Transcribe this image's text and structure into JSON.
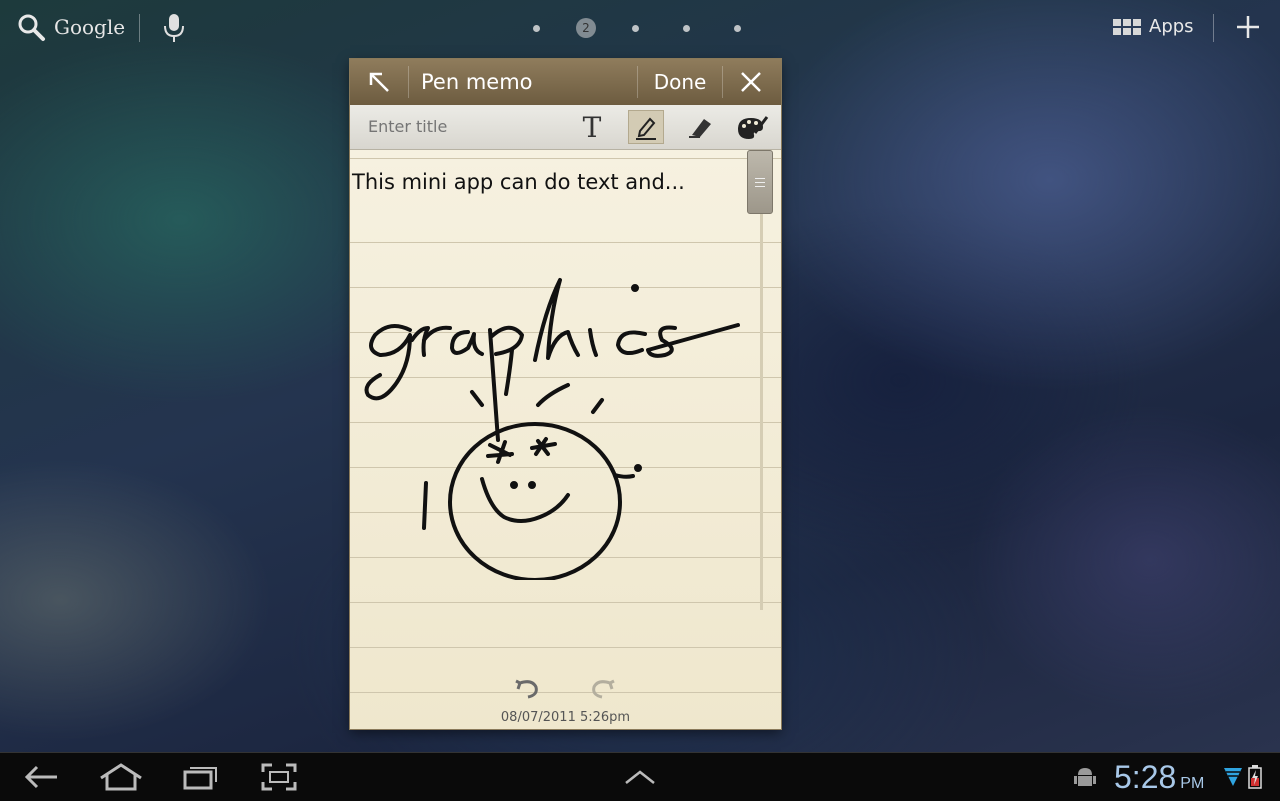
{
  "topbar": {
    "search_label": "Google",
    "page_indicator": "2",
    "apps_label": "Apps"
  },
  "memo": {
    "title": "Pen memo",
    "done_label": "Done",
    "title_placeholder": "Enter title",
    "body_text": "This mini app can do text and...",
    "handwriting": "graphics",
    "timestamp": "08/07/2011 5:26pm",
    "selected_tool": "pen"
  },
  "system": {
    "time": "5:28",
    "ampm": "PM"
  },
  "colors": {
    "memo_header": "#7d6a4d",
    "paper": "#f3ecd6",
    "clock": "#a8c8e8"
  }
}
